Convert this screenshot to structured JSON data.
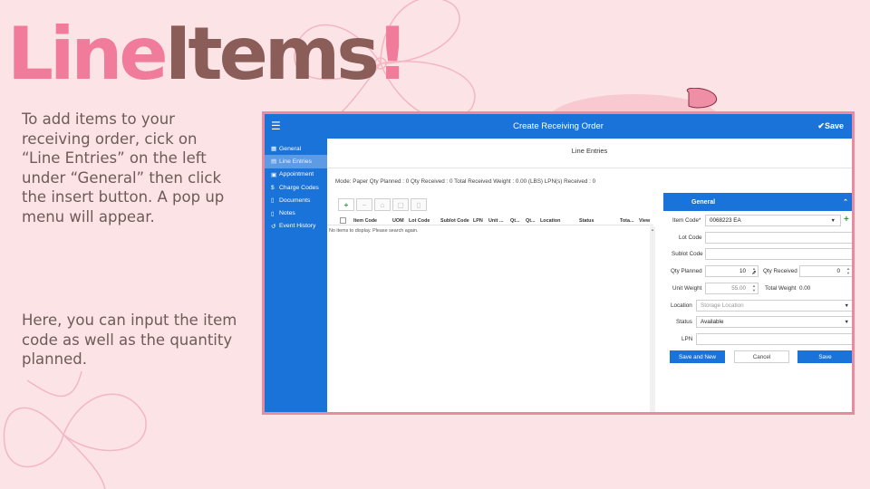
{
  "slide": {
    "title_part1": "Line",
    "title_part2": "Items",
    "title_part3": "!",
    "paragraph1": "To add items to your receiving order, cick on “Line Entries” on the left under “General” then click the insert button. A pop up menu will appear.",
    "paragraph2": "Here, you can input the item code as well as the quantity planned."
  },
  "app": {
    "title": "Create Receiving Order",
    "save_label": "Save",
    "menu_icon": "hamburger-icon"
  },
  "sidebar": {
    "items": [
      {
        "label": "General",
        "icon": "grid-icon",
        "active": false
      },
      {
        "label": "Line Entries",
        "icon": "list-icon",
        "active": true
      },
      {
        "label": "Appointment",
        "icon": "calendar-icon",
        "active": false
      },
      {
        "label": "Charge Codes",
        "icon": "dollar-icon",
        "active": false
      },
      {
        "label": "Documents",
        "icon": "document-icon",
        "active": false
      },
      {
        "label": "Notes",
        "icon": "note-icon",
        "active": false
      },
      {
        "label": "Event History",
        "icon": "history-icon",
        "active": false
      }
    ]
  },
  "section": {
    "title": "Line Entries",
    "summary": "Mode: Paper   Qty Planned : 0   Qty Received : 0   Total Received Weight : 0.00 (LBS)   LPN(s) Received : 0"
  },
  "grid": {
    "toolbar": [
      "+",
      "−",
      "⌂",
      "▢",
      "▯"
    ],
    "columns": [
      "Item Code",
      "UOM",
      "Lot Code",
      "Sublot Code",
      "LPN",
      "Unit ...",
      "Qt...",
      "Qt...",
      "Location",
      "Status",
      "Tota...",
      "View"
    ],
    "empty_message": "No items to display. Please search again."
  },
  "panel": {
    "title": "General",
    "fields": {
      "item_code_label": "Item Code*",
      "item_code_value": "0068223 EA",
      "lot_code_label": "Lot Code",
      "sublot_code_label": "Sublot Code",
      "qty_planned_label": "Qty Planned",
      "qty_planned_value": "10",
      "qty_received_label": "Qty Received",
      "qty_received_value": "0",
      "unit_weight_label": "Unit Weight",
      "unit_weight_value": "55.00",
      "total_weight_label": "Total Weight",
      "total_weight_value": "0.00",
      "location_label": "Location",
      "location_placeholder": "Storage Location",
      "status_label": "Status",
      "status_value": "Available",
      "lpn_label": "LPN"
    },
    "buttons": {
      "save_and_new": "Save and New",
      "cancel": "Cancel",
      "save": "Save"
    }
  },
  "colors": {
    "brand_blue": "#1a73d9",
    "title_pink": "#f17b9b",
    "title_brown": "#8a5d58",
    "frame_pink": "#e88aa0"
  }
}
